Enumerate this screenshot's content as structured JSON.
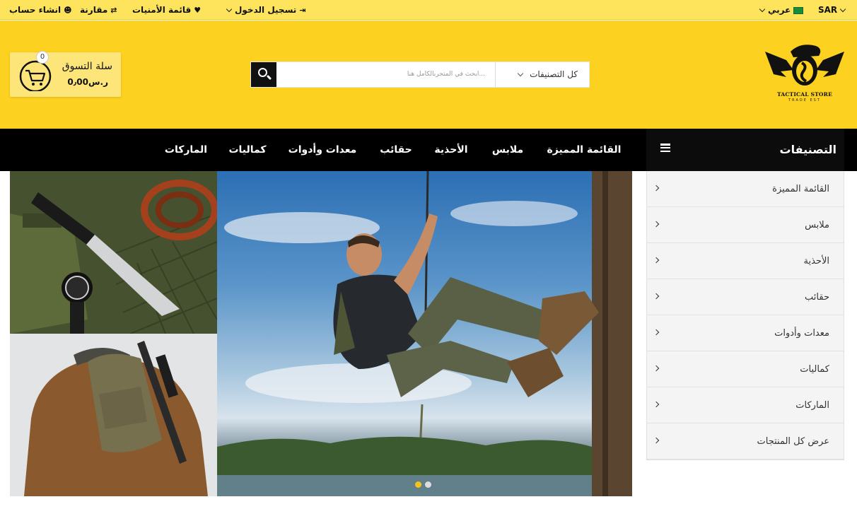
{
  "topbar": {
    "currency": "SAR",
    "language": "عربي",
    "login": "تسجيل الدخول",
    "wishlist": "قائمة الأمنيات",
    "compare": "مقارنة",
    "register": "انشاء حساب"
  },
  "header": {
    "logo_title": "TACTICAL STORE",
    "logo_subtitle": "TRADE EST",
    "search_placeholder": "ابحث في المتجربالكامل هنا...",
    "category_select": "كل التصنيفات",
    "cart_title": "سلة التسوق",
    "cart_total": "0٫00ر.س",
    "cart_count": "0"
  },
  "nav": {
    "categories_label": "التصنيفات",
    "links": [
      "القائمة المميزة",
      "ملابس",
      "الأحذية",
      "حقائب",
      "معدات وأدوات",
      "كماليات",
      "الماركات"
    ]
  },
  "sidebar": {
    "items": [
      "القائمة المميزة",
      "ملابس",
      "الأحذية",
      "حقائب",
      "معدات وأدوات",
      "كماليات",
      "الماركات",
      "عرض كل المنتجات"
    ]
  },
  "colors": {
    "brand_yellow": "#fdd11f",
    "topbar_yellow": "#fde45c",
    "nav_black": "#000000"
  },
  "icons": {
    "search": "search-icon",
    "cart": "cart-icon",
    "menu": "hamburger-icon",
    "user": "user-icon",
    "heart": "heart-icon",
    "compare": "exchange-icon",
    "login": "sign-in-icon"
  }
}
